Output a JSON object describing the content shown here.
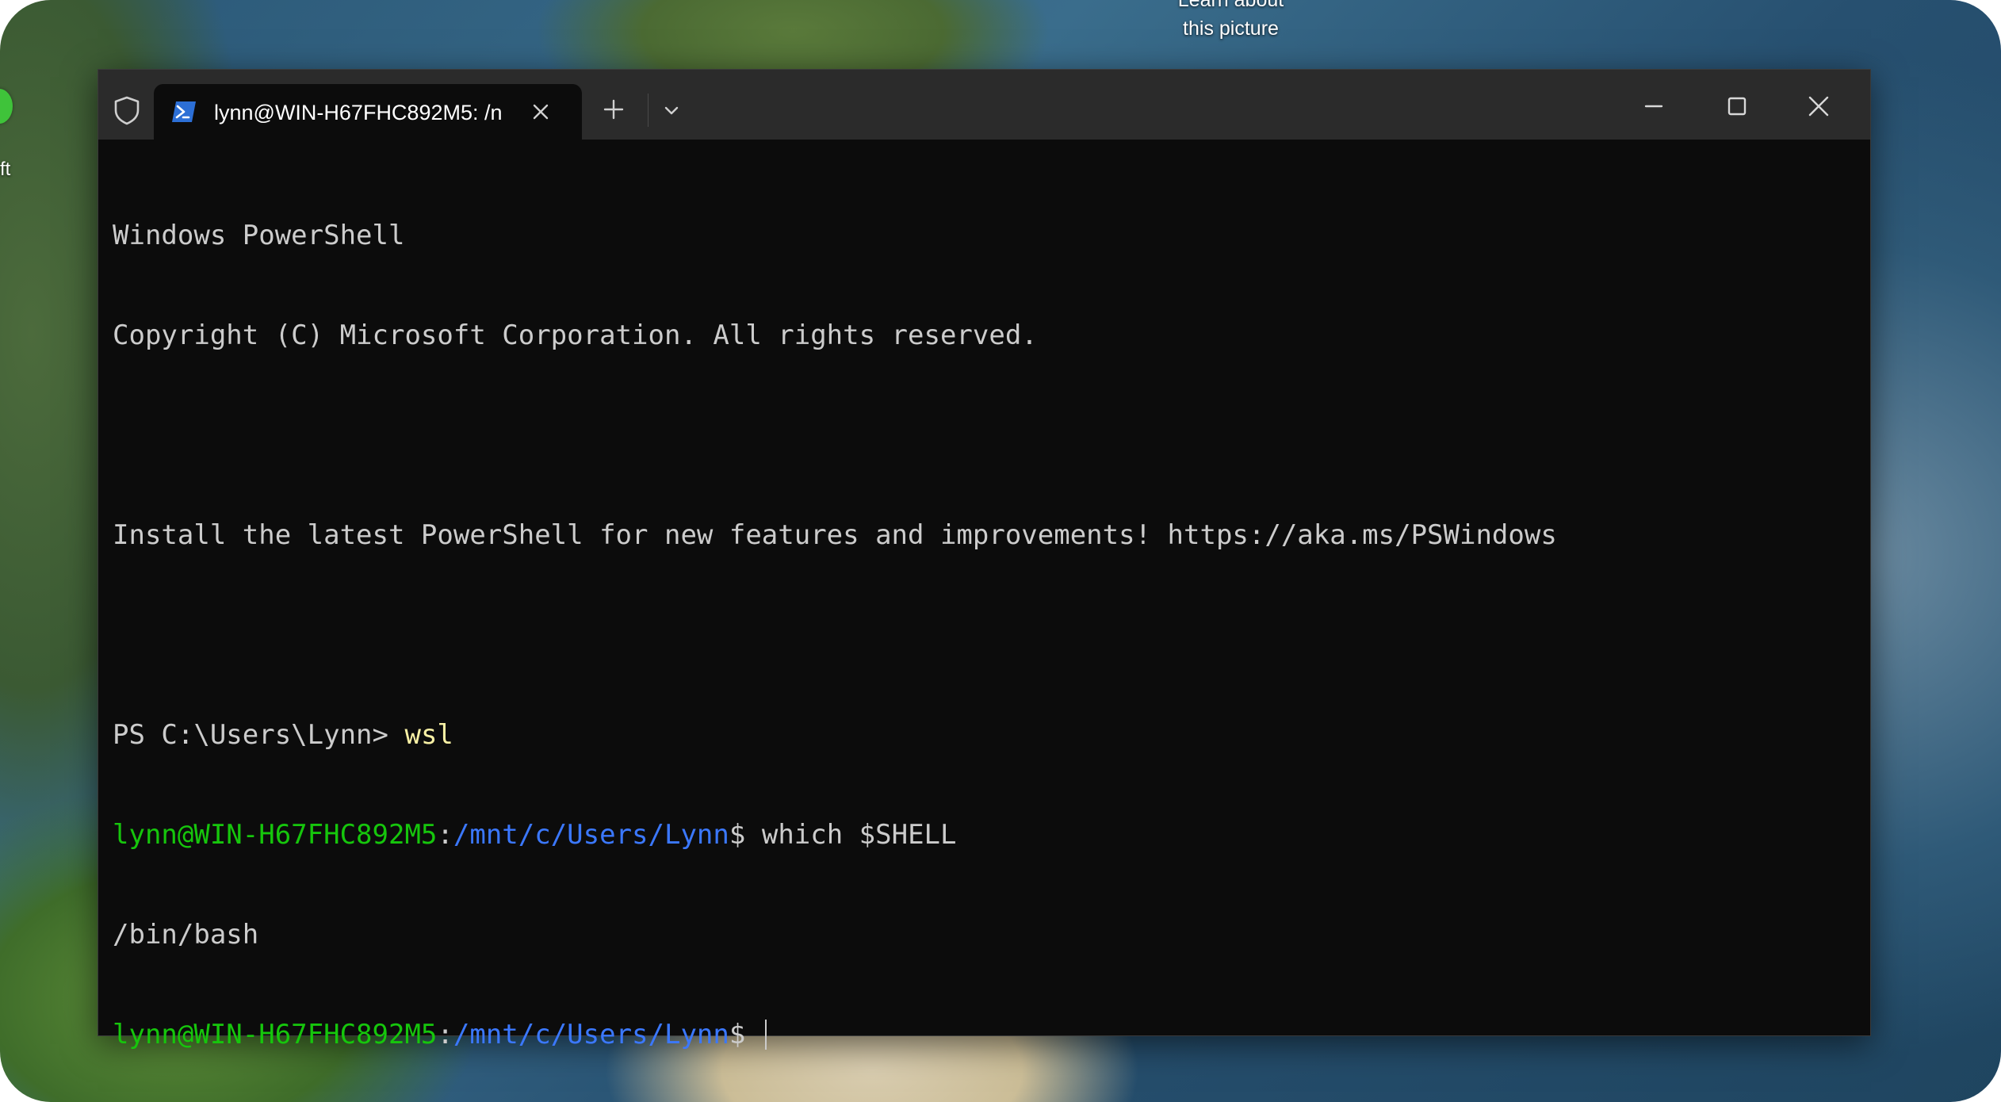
{
  "desktop": {
    "learn_line1": "Learn about",
    "learn_line2": "this picture",
    "edge_text": "ft"
  },
  "window": {
    "tab_title": "lynn@WIN-H67FHC892M5: /n",
    "icons": {
      "security": "shield-icon",
      "tab_app": "powershell-icon",
      "tab_close": "close-icon",
      "new_tab": "plus-icon",
      "dropdown": "chevron-down-icon",
      "minimize": "minimize-icon",
      "maximize": "maximize-icon",
      "close": "close-icon"
    }
  },
  "terminal": {
    "line1": "Windows PowerShell",
    "line2": "Copyright (C) Microsoft Corporation. All rights reserved.",
    "line3": "Install the latest PowerShell for new features and improvements! https://aka.ms/PSWindows",
    "ps_prompt": "PS C:\\Users\\Lynn> ",
    "ps_command": "wsl",
    "bash_user_host": "lynn@WIN-H67FHC892M5",
    "bash_colon": ":",
    "bash_path": "/mnt/c/Users/Lynn",
    "bash_dollar": "$ ",
    "bash_command": "which $SHELL",
    "output": "/bin/bash",
    "bash_user_host_2": "lynn@WIN-H67FHC892M5",
    "bash_colon_2": ":",
    "bash_path_2": "/mnt/c/Users/Lynn",
    "bash_dollar_2": "$ "
  },
  "colors": {
    "background": "#0c0c0c",
    "titlebar": "#2b2b2b",
    "foreground": "#cccccc",
    "prompt_user": "#16c60c",
    "prompt_path": "#3b78ff",
    "command_highlight": "#f9f1a5"
  }
}
